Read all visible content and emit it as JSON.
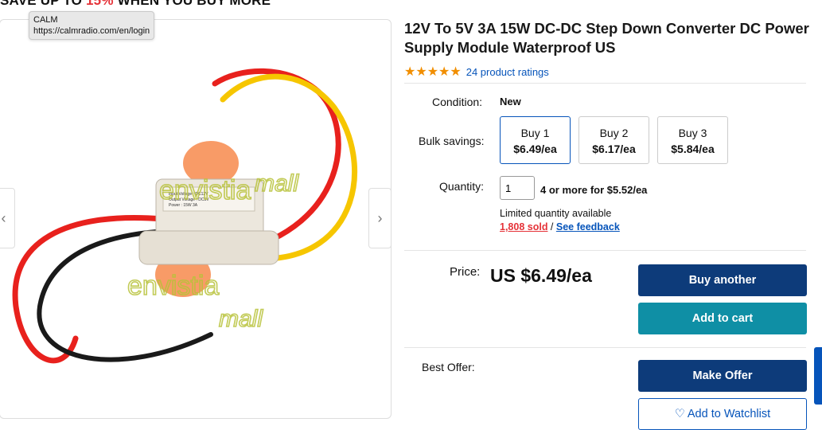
{
  "promo": {
    "prefix": "SAVE UP TO ",
    "accent": "15%",
    "suffix": " WHEN YOU BUY MORE"
  },
  "tooltip": {
    "title": "CALM",
    "url": "https://calmradio.com/en/login"
  },
  "gallery": {
    "prev_icon": "chevron-left-icon",
    "next_icon": "chevron-right-icon",
    "prev_glyph": "‹",
    "next_glyph": "›",
    "watermark": "envistia mall",
    "module_label_text": [
      "Input Voltage : DC12V",
      "Output Voltage : DC5V",
      "Power : 15W 3A"
    ]
  },
  "product": {
    "title": "12V To 5V 3A 15W DC-DC Step Down Converter DC Power Supply Module Waterproof US",
    "stars": "★★★★★",
    "ratings_link": "24 product ratings"
  },
  "condition": {
    "label": "Condition:",
    "value": "New"
  },
  "bulk": {
    "label": "Bulk savings:",
    "options": [
      {
        "qty": "Buy 1",
        "price": "$6.49/ea",
        "selected": true
      },
      {
        "qty": "Buy 2",
        "price": "$6.17/ea",
        "selected": false
      },
      {
        "qty": "Buy 3",
        "price": "$5.84/ea",
        "selected": false
      }
    ]
  },
  "quantity": {
    "label": "Quantity:",
    "value": "1",
    "note": "4 or more for $5.52/ea",
    "availability": "Limited quantity available",
    "sold": "1,808 sold",
    "separator": " / ",
    "feedback": "See feedback"
  },
  "price": {
    "label": "Price:",
    "value": "US $6.49/ea"
  },
  "buttons": {
    "buy_another": "Buy another",
    "add_to_cart": "Add to cart",
    "make_offer": "Make Offer",
    "watchlist": "Add to Watchlist",
    "watchlist_icon": "heart-icon",
    "watchlist_glyph": "♡"
  },
  "best_offer": {
    "label": "Best Offer:"
  },
  "colors": {
    "primary_button": "#0d3b7a",
    "cart_button": "#0f8fa5",
    "link": "#0654ba",
    "star": "#f18e00",
    "sold": "#e53238"
  }
}
